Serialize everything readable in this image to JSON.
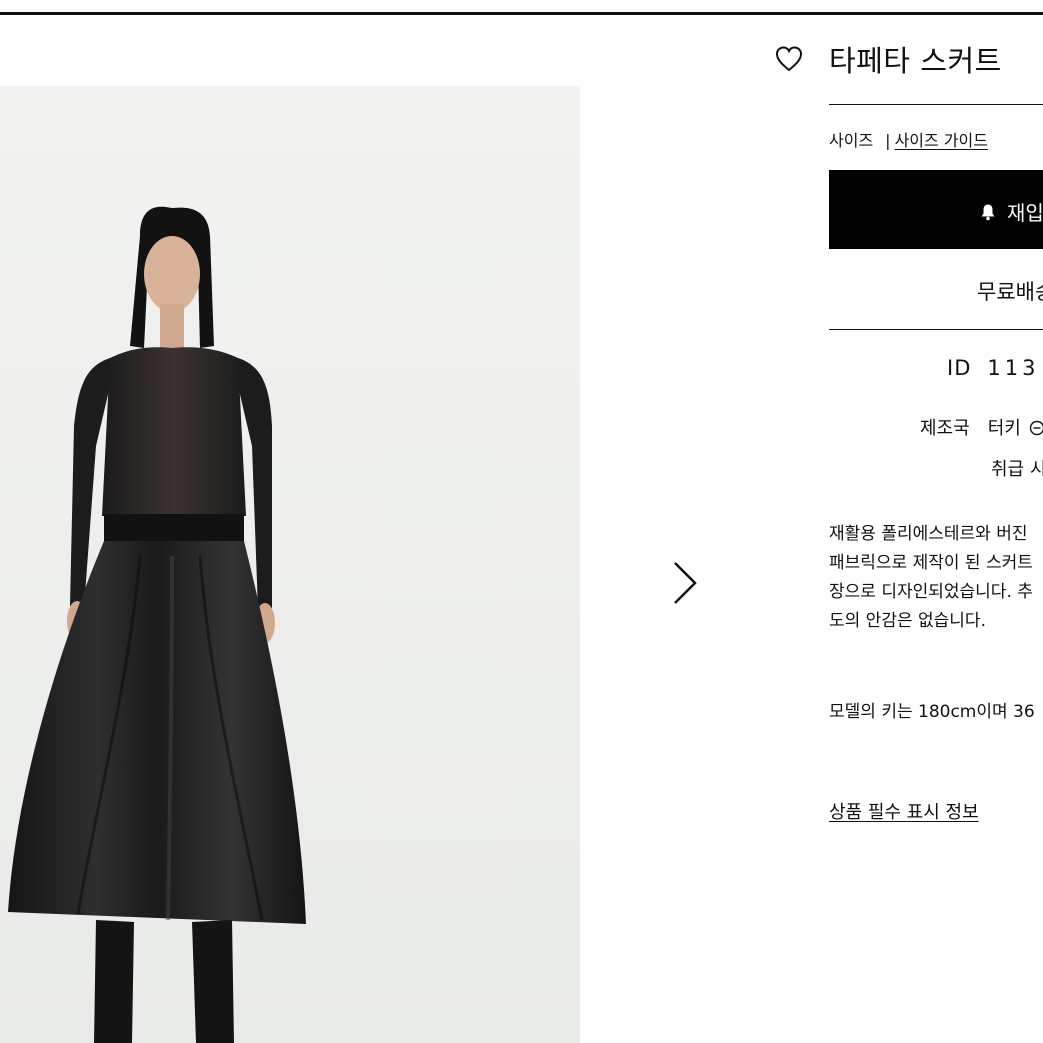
{
  "product": {
    "title": "타페타 스커트",
    "favorite_icon": "heart-outline-icon",
    "image_alt": "타페타 스커트"
  },
  "size": {
    "label": "사이즈",
    "separator": "|",
    "guide_link": "사이즈 가이드"
  },
  "restock_button": {
    "icon": "bell-icon",
    "label": "재입"
  },
  "shipping": {
    "text": "무료배송"
  },
  "details": {
    "id_label": "ID",
    "id_value": "113",
    "origin_label": "제조국",
    "origin_value": "터키",
    "origin_icon": "info-circle-icon",
    "care_label": "취급 시"
  },
  "description": {
    "lines": [
      "재활용 폴리에스테르와 버진",
      "패브릭으로 제작이 된 스커트",
      "장으로 디자인되었습니다. 추",
      "도의 안감은 없습니다."
    ]
  },
  "model": {
    "text": "모델의 키는 180cm이며 36"
  },
  "info_link": {
    "label": "상품 필수 표시 정보"
  },
  "carousel": {
    "next_icon": "chevron-right-icon"
  },
  "colors": {
    "primary": "#000000",
    "background": "#ffffff",
    "photo_background": "#f0f1ef"
  }
}
